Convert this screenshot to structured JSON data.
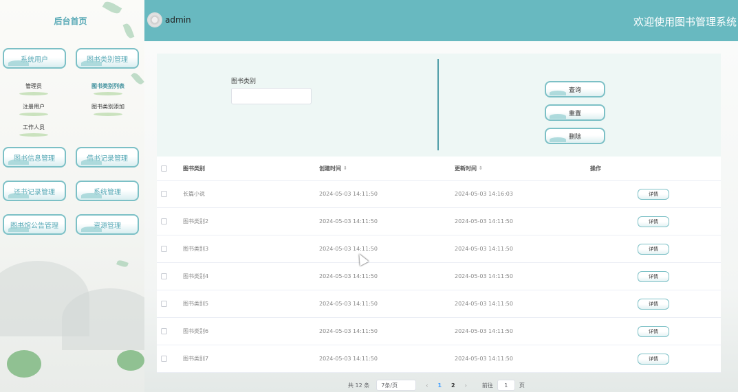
{
  "sidebar": {
    "home_label": "后台首页",
    "menu": [
      {
        "label": "系统用户"
      },
      {
        "label": "图书类别管理"
      },
      {
        "label": "图书信息管理"
      },
      {
        "label": "借书记录管理"
      },
      {
        "label": "还书记录管理"
      },
      {
        "label": "系统管理"
      },
      {
        "label": "图书馆公告管理"
      },
      {
        "label": "资源管理"
      }
    ],
    "submenu_users": [
      "管理员",
      "注册用户",
      "工作人员"
    ],
    "submenu_category": [
      "图书类别列表",
      "图书类别添加"
    ]
  },
  "header": {
    "username": "admin",
    "welcome": "欢迎使用图书管理系统"
  },
  "search": {
    "label": "图书类别",
    "value": "",
    "buttons": {
      "query": "查询",
      "reset": "重置",
      "delete": "删除"
    }
  },
  "table": {
    "columns": {
      "category": "图书类别",
      "created": "创建时间",
      "updated": "更新时间",
      "action": "操作"
    },
    "sort_icon": "sort-icon",
    "detail_label": "详情",
    "rows": [
      {
        "category": "长篇小说",
        "created": "2024-05-03 14:11:50",
        "updated": "2024-05-03 14:16:03"
      },
      {
        "category": "图书类别2",
        "created": "2024-05-03 14:11:50",
        "updated": "2024-05-03 14:11:50"
      },
      {
        "category": "图书类别3",
        "created": "2024-05-03 14:11:50",
        "updated": "2024-05-03 14:11:50"
      },
      {
        "category": "图书类别4",
        "created": "2024-05-03 14:11:50",
        "updated": "2024-05-03 14:11:50"
      },
      {
        "category": "图书类别5",
        "created": "2024-05-03 14:11:50",
        "updated": "2024-05-03 14:11:50"
      },
      {
        "category": "图书类别6",
        "created": "2024-05-03 14:11:50",
        "updated": "2024-05-03 14:11:50"
      },
      {
        "category": "图书类别7",
        "created": "2024-05-03 14:11:50",
        "updated": "2024-05-03 14:11:50"
      }
    ]
  },
  "pagination": {
    "total": "共 12 条",
    "page_size": "7条/页",
    "pages": [
      "1",
      "2"
    ],
    "current": "1",
    "goto_label": "前往",
    "goto_value": "1",
    "page_unit": "页"
  },
  "colors": {
    "accent": "#68b9c0",
    "panel": "#eef7f5",
    "active_page": "#409eff"
  }
}
